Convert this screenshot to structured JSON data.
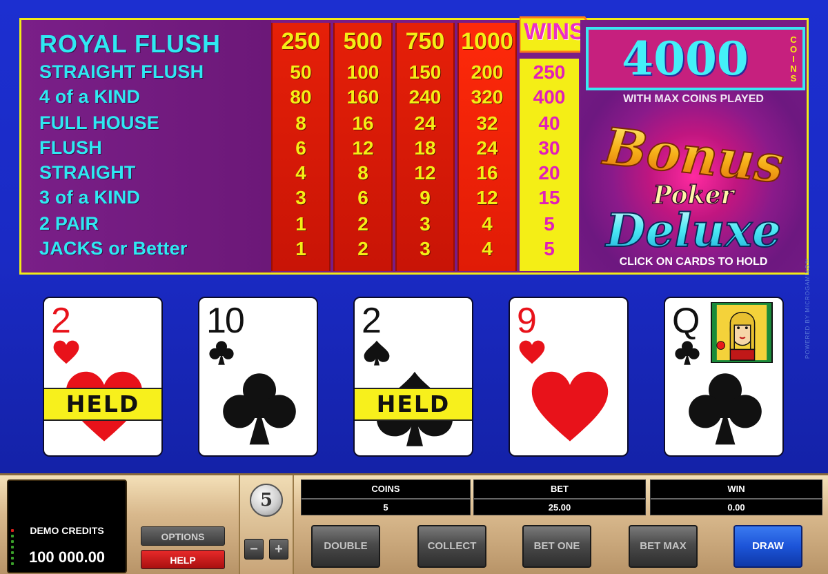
{
  "paytable": {
    "hands": [
      {
        "name": "ROYAL FLUSH",
        "pays": [
          "250",
          "500",
          "750",
          "1000"
        ],
        "win": ""
      },
      {
        "name": "STRAIGHT FLUSH",
        "pays": [
          "50",
          "100",
          "150",
          "200"
        ],
        "win": "250"
      },
      {
        "name": "4 of a KIND",
        "pays": [
          "80",
          "160",
          "240",
          "320"
        ],
        "win": "400"
      },
      {
        "name": "FULL HOUSE",
        "pays": [
          "8",
          "16",
          "24",
          "32"
        ],
        "win": "40"
      },
      {
        "name": "FLUSH",
        "pays": [
          "6",
          "12",
          "18",
          "24"
        ],
        "win": "30"
      },
      {
        "name": "STRAIGHT",
        "pays": [
          "4",
          "8",
          "12",
          "16"
        ],
        "win": "20"
      },
      {
        "name": "3 of a KIND",
        "pays": [
          "3",
          "6",
          "9",
          "12"
        ],
        "win": "15"
      },
      {
        "name": "2 PAIR",
        "pays": [
          "1",
          "2",
          "3",
          "4"
        ],
        "win": "5"
      },
      {
        "name": "JACKS or Better",
        "pays": [
          "1",
          "2",
          "3",
          "4"
        ],
        "win": "5"
      }
    ],
    "wins_label": "WINS",
    "jackpot": {
      "amount": "4000",
      "unit": "COINS",
      "note": "WITH MAX COINS PLAYED"
    },
    "logo": {
      "line1": "Bonus",
      "line2": "Poker",
      "line3": "Deluxe"
    },
    "hold_hint": "CLICK ON CARDS TO HOLD"
  },
  "cards": [
    {
      "rank": "2",
      "suit": "hearts",
      "held": true
    },
    {
      "rank": "10",
      "suit": "clubs",
      "held": false
    },
    {
      "rank": "2",
      "suit": "spades",
      "held": true
    },
    {
      "rank": "9",
      "suit": "hearts",
      "held": false
    },
    {
      "rank": "Q",
      "suit": "clubs",
      "held": false
    }
  ],
  "held_label": "HELD",
  "side_credit": "POWERED BY MICROGAMING™",
  "controls": {
    "credits_label": "DEMO CREDITS",
    "credits_value": "100 000.00",
    "options_label": "OPTIONS",
    "help_label": "HELP",
    "coin_value": "5",
    "minus_label": "−",
    "plus_label": "+",
    "readouts": {
      "coins": {
        "label": "COINS",
        "value": "5"
      },
      "bet": {
        "label": "BET",
        "value": "25.00"
      },
      "win": {
        "label": "WIN",
        "value": "0.00"
      }
    },
    "buttons": {
      "double": "DOUBLE",
      "collect": "COLLECT",
      "bet_one": "BET ONE",
      "bet_max": "BET MAX",
      "draw": "DRAW"
    }
  },
  "colors": {
    "hand_name": "#2fe8f2",
    "pay_value": "#f4ee16",
    "win_value": "#e020b8",
    "held_banner": "#f7f01c",
    "draw_button": "#1c54d8",
    "help_button": "#d01818"
  }
}
